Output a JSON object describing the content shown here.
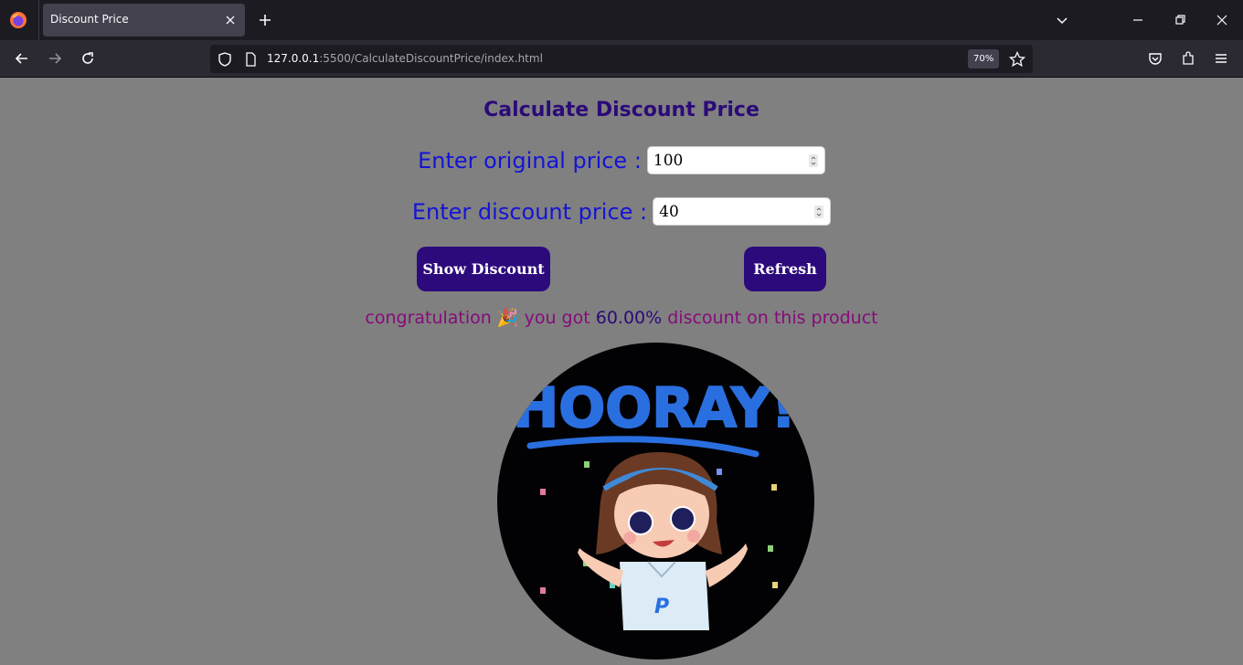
{
  "browser": {
    "tab_title": "Discount Price",
    "url_host": "127.0.0.1",
    "url_path": ":5500/CalculateDiscountPrice/index.html",
    "zoom": "70%"
  },
  "page": {
    "title": "Calculate Discount Price",
    "original_label": "Enter original price :",
    "original_value": "100",
    "discount_label": "Enter discount price :",
    "discount_value": "40",
    "show_button": "Show Discount",
    "refresh_button": "Refresh",
    "msg_prefix": "congratulation",
    "msg_emoji": "🎉",
    "msg_middle": "you got",
    "msg_percent": "60.00%",
    "msg_suffix": "discount on this product",
    "image_text": "HOORAY!",
    "shirt_letter": "P"
  },
  "colors": {
    "page_bg": "#808080",
    "title": "#2b0a78",
    "label": "#1414d6",
    "button": "#2d0a7c",
    "message": "#860b7a"
  }
}
